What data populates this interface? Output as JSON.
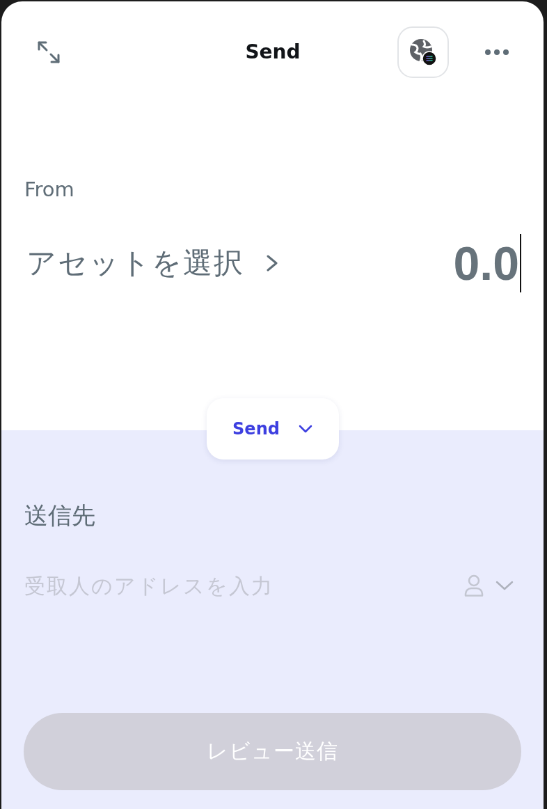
{
  "header": {
    "title": "Send"
  },
  "from": {
    "label": "From",
    "asset_selector": "アセットを選択",
    "amount": "0.0"
  },
  "mode_dropdown": {
    "label": "Send"
  },
  "recipient": {
    "label": "送信先",
    "address_field": {
      "placeholder": "受取人のアドレスを入力"
    }
  },
  "review_button": {
    "label": "レビュー送信",
    "disabled": true
  }
}
